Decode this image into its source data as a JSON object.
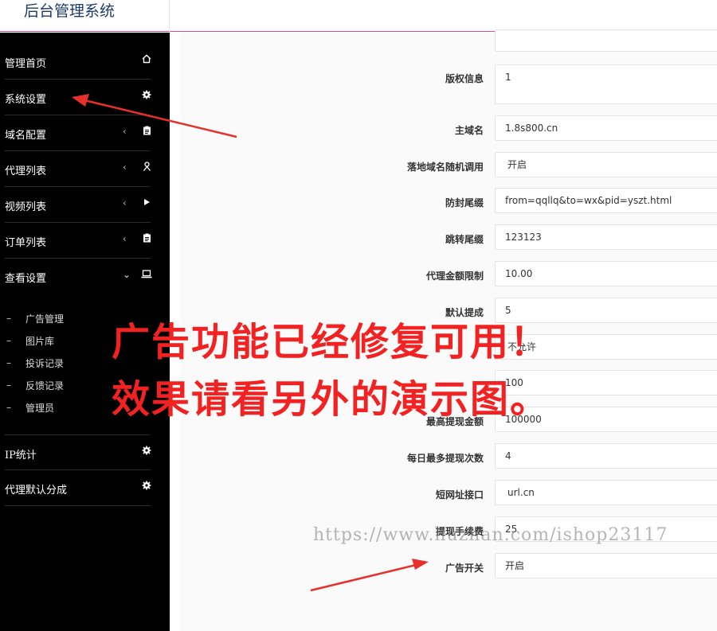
{
  "app": {
    "title": "后台管理系统"
  },
  "sidebar": {
    "items": [
      {
        "label": "管理首页",
        "chevron": "",
        "icon": "home-icon"
      },
      {
        "label": "系统设置",
        "chevron": "",
        "icon": "gear-icon"
      },
      {
        "label": "域名配置",
        "chevron": "‹",
        "icon": "clipboard-icon"
      },
      {
        "label": "代理列表",
        "chevron": "‹",
        "icon": "user-icon"
      },
      {
        "label": "视频列表",
        "chevron": "‹",
        "icon": "play-icon"
      },
      {
        "label": "订单列表",
        "chevron": "‹",
        "icon": "clipboard-icon"
      },
      {
        "label": "查看设置",
        "chevron": "⌄",
        "icon": "laptop-icon"
      }
    ],
    "sub_items": [
      {
        "dash": "–",
        "label": "广告管理"
      },
      {
        "dash": "–",
        "label": "图片库"
      },
      {
        "dash": "–",
        "label": "投诉记录"
      },
      {
        "dash": "–",
        "label": "反馈记录"
      },
      {
        "dash": "–",
        "label": "管理员"
      }
    ],
    "bottom_items": [
      {
        "label": "IP统计",
        "chevron": "",
        "icon": "gear-icon"
      },
      {
        "label": "代理默认分成",
        "chevron": "",
        "icon": "gear-icon"
      }
    ]
  },
  "form": {
    "rows": [
      {
        "label": "版权信息",
        "value": "1"
      },
      {
        "label": "主域名",
        "value": "1.8s800.cn"
      },
      {
        "label": "落地域名随机调用",
        "value": "开启"
      },
      {
        "label": "防封尾缀",
        "value": "from=qqllq&to=wx&pid=yszt.html"
      },
      {
        "label": "跳转尾缀",
        "value": "123123"
      },
      {
        "label": "代理金额限制",
        "value": "10.00"
      },
      {
        "label": "默认提成",
        "value": "5"
      },
      {
        "label": "",
        "value": "不允许"
      },
      {
        "label": "",
        "value": "100"
      },
      {
        "label": "最高提现金额",
        "value": "100000"
      },
      {
        "label": "每日最多提现次数",
        "value": "4"
      },
      {
        "label": "短网址接口",
        "value": "url.cn"
      },
      {
        "label": "提现手续费",
        "value": "25"
      },
      {
        "label": "广告开关",
        "value": "开启"
      }
    ]
  },
  "overlay": {
    "line1": "广告功能已经修复可用！",
    "line2": "效果请看另外的演示图。"
  },
  "watermark": "https://www.huzhan.com/ishop23117",
  "colors": {
    "arrow": "#e8302a",
    "overlay_text": "#f32222",
    "topbar_accent": "#e24a8a"
  }
}
